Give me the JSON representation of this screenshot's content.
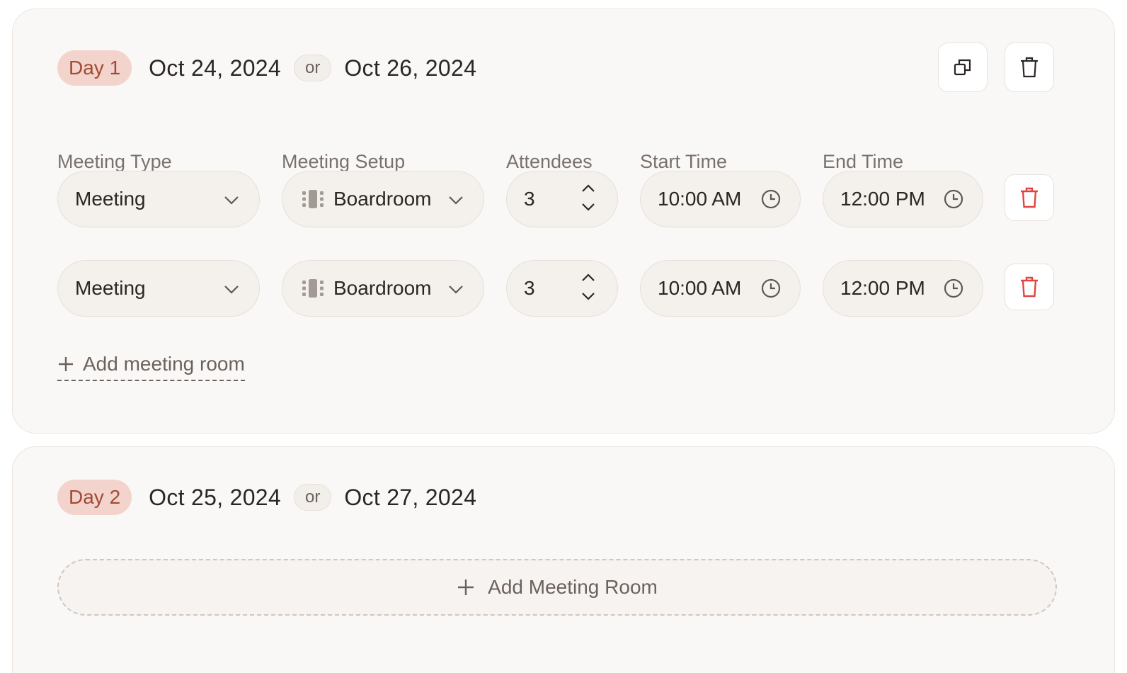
{
  "days": [
    {
      "badge": "Day 1",
      "date_primary": "Oct 24, 2024",
      "or_label": "or",
      "date_alternate": "Oct 26, 2024",
      "labels": {
        "meeting_type": "Meeting Type",
        "meeting_setup": "Meeting Setup",
        "attendees": "Attendees",
        "start_time": "Start Time",
        "end_time": "End Time"
      },
      "rooms": [
        {
          "meeting_type": "Meeting",
          "meeting_setup": "Boardroom",
          "attendees": "3",
          "start_time": "10:00 AM",
          "end_time": "12:00 PM"
        },
        {
          "meeting_type": "Meeting",
          "meeting_setup": "Boardroom",
          "attendees": "3",
          "start_time": "10:00 AM",
          "end_time": "12:00 PM"
        }
      ],
      "add_room_link": "Add meeting room"
    },
    {
      "badge": "Day 2",
      "date_primary": "Oct 25, 2024",
      "or_label": "or",
      "date_alternate": "Oct 27, 2024",
      "add_room_button": "Add Meeting Room"
    }
  ],
  "colors": {
    "badge_bg": "#f2d4cd",
    "badge_text": "#a24a33",
    "delete_red": "#e0463f",
    "card_bg": "#faf8f6"
  }
}
